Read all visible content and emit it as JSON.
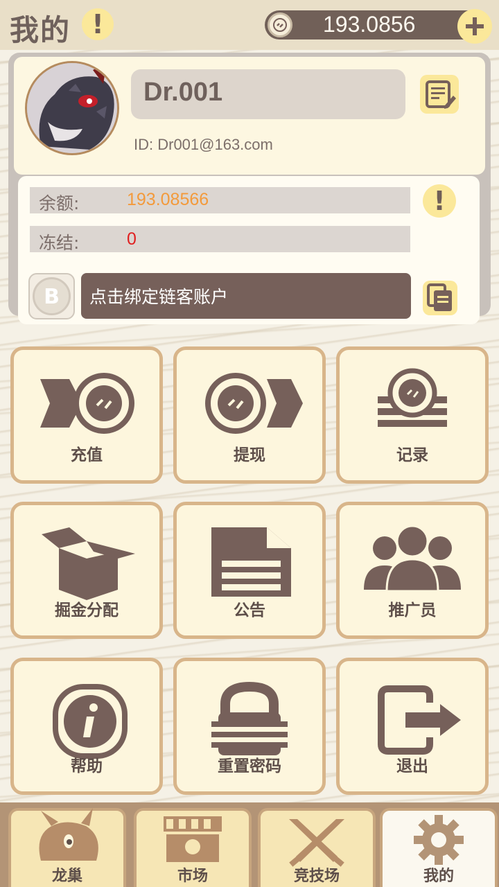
{
  "header": {
    "title": "我的",
    "balance": "193.0856",
    "warn_icon": "exclamation-icon",
    "coin_icon": "coin-icon",
    "add_icon": "plus-icon"
  },
  "profile": {
    "name": "Dr.001",
    "id_text": "ID: Dr001@163.com",
    "avatar_icon": "dragon-avatar",
    "edit_icon": "edit-note-icon"
  },
  "wallet": {
    "balance_label": "余额:",
    "balance_value": "193.08566",
    "frozen_label": "冻结:",
    "frozen_value": "0",
    "bind_label": "点击绑定链客账户",
    "balance_color": "#f39a3b",
    "frozen_color": "#e02020"
  },
  "tiles": [
    {
      "label": "充值",
      "icon": "deposit-icon"
    },
    {
      "label": "提现",
      "icon": "withdraw-icon"
    },
    {
      "label": "记录",
      "icon": "records-icon"
    },
    {
      "label": "掘金分配",
      "icon": "box-icon"
    },
    {
      "label": "公告",
      "icon": "document-icon"
    },
    {
      "label": "推广员",
      "icon": "group-icon"
    },
    {
      "label": "帮助",
      "icon": "info-icon"
    },
    {
      "label": "重置密码",
      "icon": "lock-icon"
    },
    {
      "label": "退出",
      "icon": "logout-icon"
    }
  ],
  "nav": [
    {
      "label": "龙巢",
      "icon": "dragon-icon"
    },
    {
      "label": "市场",
      "icon": "shop-icon"
    },
    {
      "label": "竞技场",
      "icon": "swords-icon"
    },
    {
      "label": "我的",
      "icon": "gear-icon"
    }
  ],
  "colors": {
    "brown": "#76605a",
    "yellow": "#fbe89a",
    "cream": "#fdf6dd"
  }
}
